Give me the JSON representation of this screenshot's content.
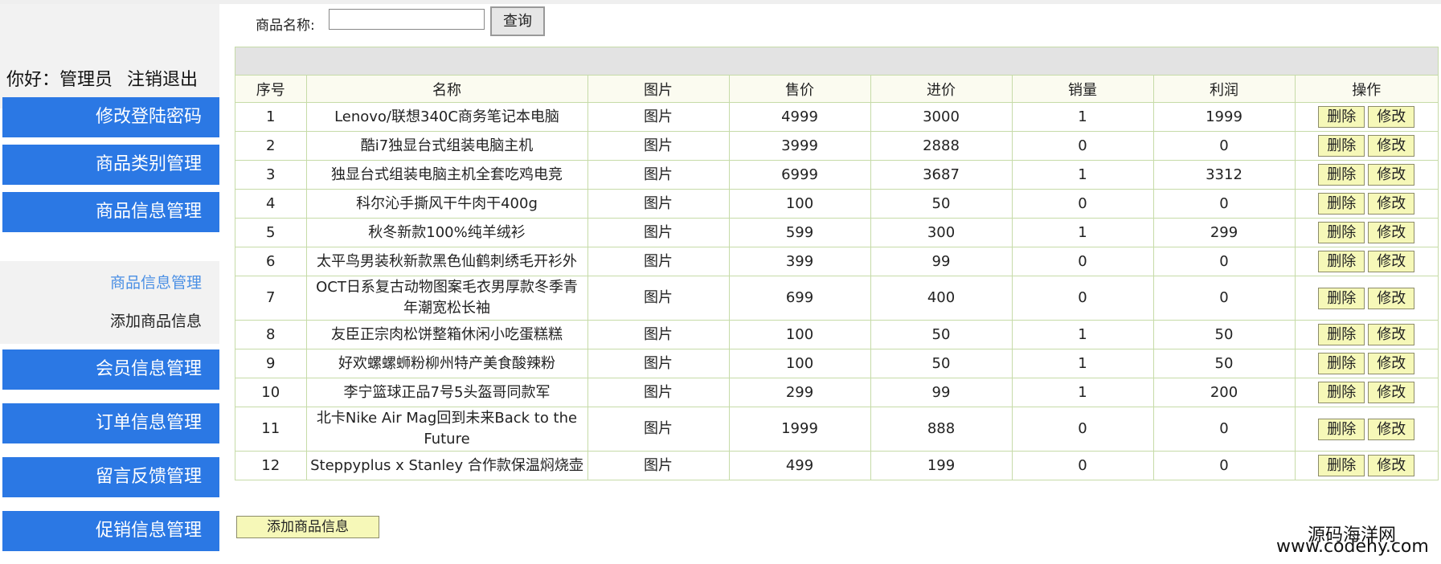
{
  "sidebar": {
    "greeting": "你好：管理员",
    "logout": "注销退出",
    "menu": [
      {
        "label": "修改登陆密码"
      },
      {
        "label": "商品类别管理"
      },
      {
        "label": "商品信息管理"
      },
      {
        "label": "会员信息管理"
      },
      {
        "label": "订单信息管理"
      },
      {
        "label": "留言反馈管理"
      },
      {
        "label": "促销信息管理"
      }
    ],
    "submenu": [
      {
        "label": "商品信息管理",
        "active": true
      },
      {
        "label": "添加商品信息",
        "active": false
      }
    ]
  },
  "search": {
    "label": "商品名称:",
    "value": "",
    "placeholder": "",
    "button": "查询"
  },
  "table": {
    "headers": [
      "序号",
      "名称",
      "图片",
      "售价",
      "进价",
      "销量",
      "利润",
      "操作"
    ],
    "delete_label": "删除",
    "edit_label": "修改",
    "rows": [
      {
        "no": "1",
        "name": "Lenovo/联想340C商务笔记本电脑",
        "image": "图片",
        "price": "4999",
        "cost": "3000",
        "sales": "1",
        "profit": "1999"
      },
      {
        "no": "2",
        "name": "酷i7独显台式组装电脑主机",
        "image": "图片",
        "price": "3999",
        "cost": "2888",
        "sales": "0",
        "profit": "0"
      },
      {
        "no": "3",
        "name": "独显台式组装电脑主机全套吃鸡电竞",
        "image": "图片",
        "price": "6999",
        "cost": "3687",
        "sales": "1",
        "profit": "3312"
      },
      {
        "no": "4",
        "name": "科尔沁手撕风干牛肉干400g",
        "image": "图片",
        "price": "100",
        "cost": "50",
        "sales": "0",
        "profit": "0"
      },
      {
        "no": "5",
        "name": "秋冬新款100%纯羊绒衫",
        "image": "图片",
        "price": "599",
        "cost": "300",
        "sales": "1",
        "profit": "299"
      },
      {
        "no": "6",
        "name": "太平鸟男装秋新款黑色仙鹤刺绣毛开衫外",
        "image": "图片",
        "price": "399",
        "cost": "99",
        "sales": "0",
        "profit": "0"
      },
      {
        "no": "7",
        "name": "OCT日系复古动物图案毛衣男厚款冬季青年潮宽松长袖",
        "image": "图片",
        "price": "699",
        "cost": "400",
        "sales": "0",
        "profit": "0"
      },
      {
        "no": "8",
        "name": "友臣正宗肉松饼整箱休闲小吃蛋糕糕",
        "image": "图片",
        "price": "100",
        "cost": "50",
        "sales": "1",
        "profit": "50"
      },
      {
        "no": "9",
        "name": "好欢螺螺蛳粉柳州特产美食酸辣粉",
        "image": "图片",
        "price": "100",
        "cost": "50",
        "sales": "1",
        "profit": "50"
      },
      {
        "no": "10",
        "name": "李宁篮球正品7号5头盔哥同款军",
        "image": "图片",
        "price": "299",
        "cost": "99",
        "sales": "1",
        "profit": "200"
      },
      {
        "no": "11",
        "name": "北卡Nike Air Mag回到未来Back to the Future",
        "image": "图片",
        "price": "1999",
        "cost": "888",
        "sales": "0",
        "profit": "0"
      },
      {
        "no": "12",
        "name": "Steppyplus x Stanley 合作款保温焖烧壶",
        "image": "图片",
        "price": "499",
        "cost": "199",
        "sales": "0",
        "profit": "0"
      }
    ]
  },
  "add_button": "添加商品信息",
  "watermark": {
    "line1": "源码海洋网",
    "line2": "www.codehy.com"
  },
  "colors": {
    "menu_bg": "#2b78e4",
    "button_bg": "#f6f8b8",
    "table_border": "#c6dba8",
    "active_sub": "#4a8fe4"
  }
}
